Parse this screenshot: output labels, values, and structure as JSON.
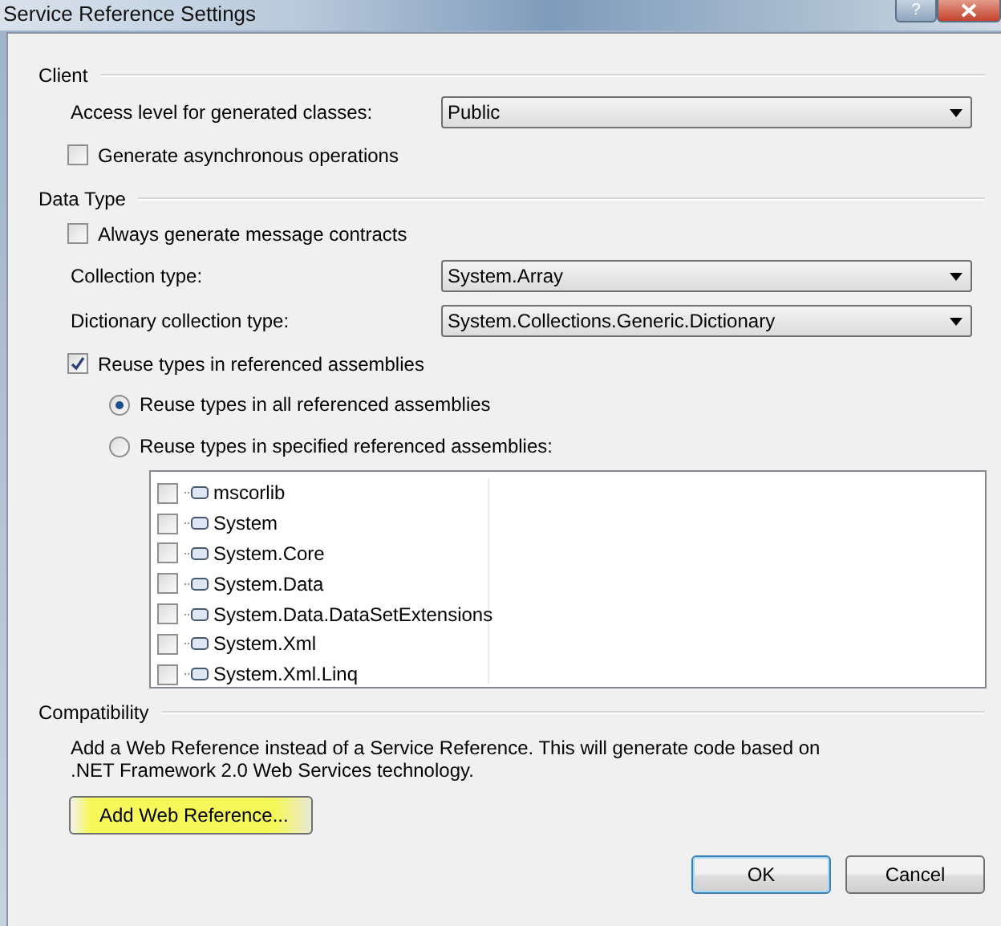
{
  "window": {
    "title": "Service Reference Settings",
    "help_button": "?"
  },
  "sections": [
    {
      "title": "Client",
      "rows": [
        {
          "kind": "dropdown",
          "label": "Access level for generated classes:",
          "value": "Public"
        },
        {
          "kind": "checkbox",
          "label": "Generate asynchronous operations",
          "checked": false
        }
      ]
    },
    {
      "title": "Data Type",
      "rows": [
        {
          "kind": "checkbox",
          "label": "Always generate message contracts",
          "checked": false
        },
        {
          "kind": "dropdown",
          "label": "Collection type:",
          "value": "System.Array"
        },
        {
          "kind": "dropdown",
          "label": "Dictionary collection type:",
          "value": "System.Collections.Generic.Dictionary"
        },
        {
          "kind": "checkbox",
          "label": "Reuse types in referenced assemblies",
          "checked": true
        },
        {
          "kind": "radio",
          "label": "Reuse types in all referenced assemblies",
          "selected": true
        },
        {
          "kind": "radio",
          "label": "Reuse types in specified referenced assemblies:",
          "selected": false
        },
        {
          "kind": "assemblies",
          "items": [
            {
              "name": "mscorlib",
              "checked": false
            },
            {
              "name": "System",
              "checked": false
            },
            {
              "name": "System.Core",
              "checked": false
            },
            {
              "name": "System.Data",
              "checked": false
            },
            {
              "name": "System.Data.DataSetExtensions",
              "checked": false
            },
            {
              "name": "System.Xml",
              "checked": false
            },
            {
              "name": "System.Xml.Linq",
              "checked": false
            }
          ]
        }
      ]
    },
    {
      "title": "Compatibility",
      "rows": [
        {
          "kind": "text",
          "text": "Add a Web Reference instead of a Service Reference. This will generate code based on .NET Framework 2.0 Web Services technology."
        },
        {
          "kind": "button",
          "label": "Add Web Reference...",
          "highlighted": true
        }
      ]
    }
  ],
  "buttons": [
    "OK",
    "Cancel"
  ]
}
